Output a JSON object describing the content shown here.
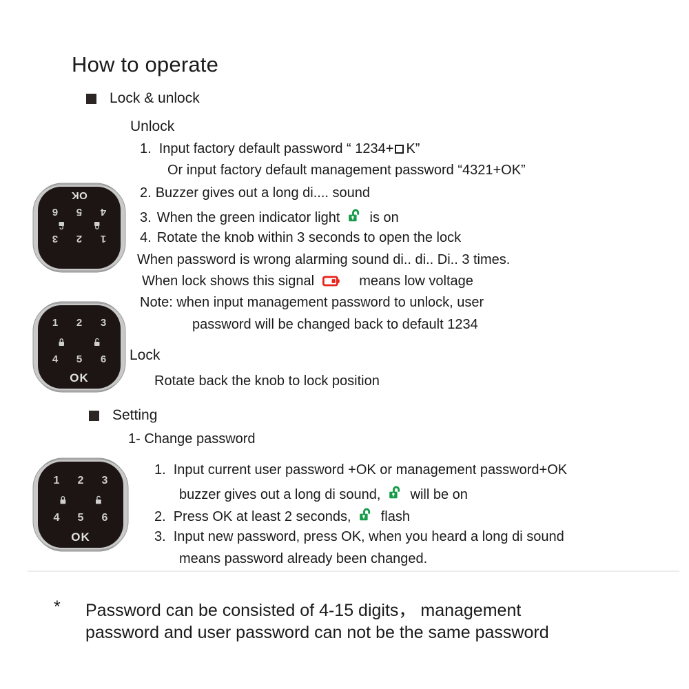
{
  "document": {
    "title": "How to operate"
  },
  "sections": {
    "lock_unlock": {
      "heading": "Lock & unlock",
      "unlock_label": "Unlock",
      "unlock_steps": [
        {
          "num": "1.",
          "text_before_box": "Input factory default password  “ 1234+",
          "text_after_box": "K”"
        },
        {
          "num": "",
          "text": "Or input factory default management password  “4321+OK”"
        },
        {
          "num": "2.",
          "text": "Buzzer gives out a long di.... sound"
        },
        {
          "num": "3.",
          "text_before_icon": "When the green indicator light",
          "icon": "unlock-green-icon",
          "text_after_icon": "is on"
        },
        {
          "num": "4.",
          "text": "Rotate the knob within 3 seconds to open the lock"
        }
      ],
      "notes": [
        {
          "text": "When password is wrong alarming sound di.. di.. Di.. 3 times."
        },
        {
          "text_before_icon": "When lock shows this signal",
          "icon": "low-battery-icon",
          "text_after_icon": "means low voltage"
        },
        {
          "text": "Note: when input management password to unlock, user"
        },
        {
          "text": "password will be changed back to default 1234"
        }
      ],
      "lock_label": "Lock",
      "lock_text": "Rotate back the knob to lock  position"
    },
    "setting": {
      "heading": "Setting",
      "sub_heading": "1- Change password",
      "steps": [
        {
          "num": "1.",
          "text_line1": "Input current user password +OK or management password+OK"
        },
        {
          "num": "",
          "text_before_icon": "buzzer gives out a long di sound,",
          "icon": "unlock-green-icon",
          "text_after_icon": "will be on"
        },
        {
          "num": "2.",
          "text_before_icon": "Press OK at least 2 seconds,",
          "icon": "unlock-green-icon",
          "text_after_icon": "flash"
        },
        {
          "num": "3.",
          "text_line1": "Input new password, press OK, when you heard a long di sound"
        },
        {
          "num": "",
          "text": "means password already been changed."
        }
      ]
    }
  },
  "footnote": {
    "marker": "*",
    "line1": "Password can be consisted of 4-15 digits，  management",
    "line2": "password and user password can not be the same password"
  },
  "keypads": [
    {
      "name": "keypad-rotated",
      "orientation": "rotated-180",
      "keys_row1": [
        "1",
        "2",
        "3"
      ],
      "keys_row2": [
        "lock-closed-icon",
        "lock-open-icon"
      ],
      "keys_row3": [
        "4",
        "5",
        "6"
      ],
      "ok_label": "OK"
    },
    {
      "name": "keypad-upright-lock",
      "orientation": "upright",
      "keys_row1": [
        "1",
        "2",
        "3"
      ],
      "keys_row2": [
        "lock-closed-icon",
        "lock-open-icon"
      ],
      "keys_row3": [
        "4",
        "5",
        "6"
      ],
      "ok_label": "OK"
    },
    {
      "name": "keypad-upright-setting",
      "orientation": "upright",
      "keys_row1": [
        "1",
        "2",
        "3"
      ],
      "keys_row2": [
        "lock-closed-icon",
        "lock-open-icon"
      ],
      "keys_row3": [
        "4",
        "5",
        "6"
      ],
      "ok_label": "OK"
    }
  ],
  "colors": {
    "green": "#169b48",
    "red": "#e8221c",
    "text": "#1a1a1a",
    "bullet": "#2b2523",
    "keypad_face": "#1c1513",
    "keypad_rim": "#9a9a9a",
    "divider": "#ededed"
  }
}
